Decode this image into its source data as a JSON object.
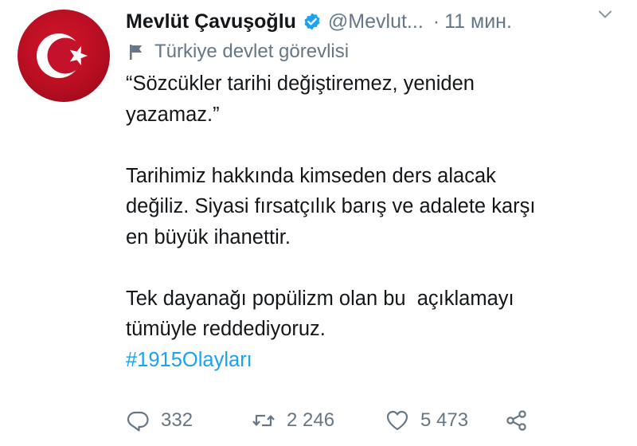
{
  "tweet": {
    "author_name": "Mevlüt Çavuşoğlu",
    "handle": "@Mevlut...",
    "separator": "·",
    "time": "11 мин.",
    "label": "Türkiye devlet görevlisi",
    "paragraphs": [
      "“Sözcükler tarihi değiştiremez, yeniden\nyazamaz.”",
      "Tarihimiz hakkında kimseden ders alacak\ndeğiliz. Siyasi fırsatçılık barış ve adalete karşı\nen büyük ihanettir.",
      "Tek dayanağı popülizm olan bu  açıklamayı\ntümüyle reddediyoruz."
    ],
    "hashtag": "#1915Olayları"
  },
  "actions": {
    "replies": "332",
    "retweets": "2 246",
    "likes": "5 473"
  },
  "icons": {
    "avatar": "turkish-flag-crescent-star",
    "verified": "verified-badge-icon",
    "menu": "chevron-down-icon",
    "label": "flag-icon",
    "reply": "reply-icon",
    "retweet": "retweet-icon",
    "like": "heart-icon",
    "share": "share-icon"
  },
  "colors": {
    "accent": "#1da1f2",
    "muted": "#657786",
    "text": "#14171a",
    "avatar_red": "#c8102e"
  }
}
